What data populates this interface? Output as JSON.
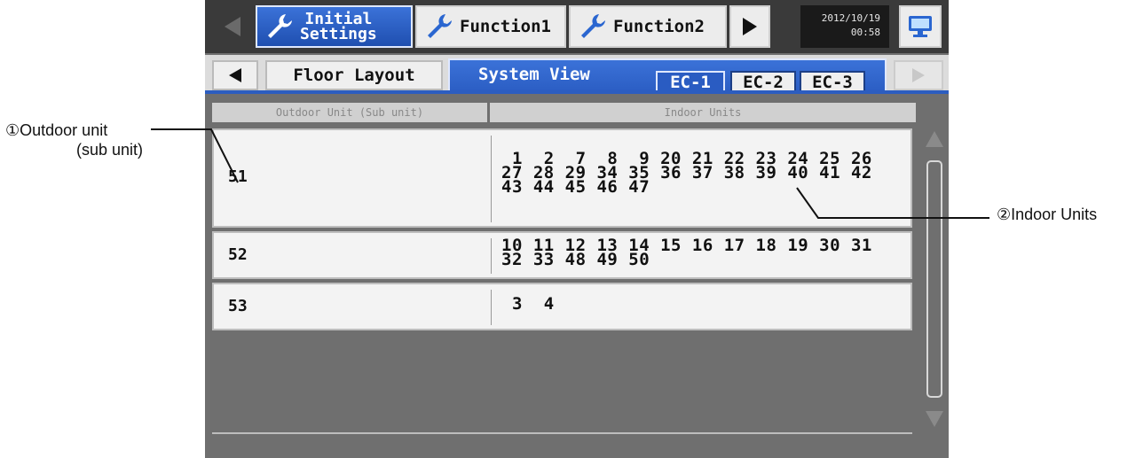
{
  "annotations": {
    "outdoor_line1": "①Outdoor unit",
    "outdoor_line2": "(sub unit)",
    "indoor": "②Indoor Units"
  },
  "header": {
    "tab_initial_line1": "Initial",
    "tab_initial_line2": "Settings",
    "tab_function1": "Function1",
    "tab_function2": "Function2",
    "date": "2012/10/19",
    "time": "00:58"
  },
  "subnav": {
    "floor_layout": "Floor Layout",
    "system_view": "System View",
    "ec_tabs": [
      "EC-1",
      "EC-2",
      "EC-3"
    ],
    "active_ec": "EC-1"
  },
  "table": {
    "col_outdoor": "Outdoor Unit (Sub unit)",
    "col_indoor": "Indoor Units",
    "rows": [
      {
        "id": "51",
        "units": " 1  2  7  8  9 20 21 22 23 24 25 26\n27 28 29 34 35 36 37 38 39 40 41 42\n43 44 45 46 47"
      },
      {
        "id": "52",
        "units": "10 11 12 13 14 15 16 17 18 19 30 31\n32 33 48 49 50"
      },
      {
        "id": "53",
        "units": " 3  4"
      }
    ]
  },
  "colors": {
    "active_tab": "#2a5fc7",
    "screen_bg": "#6f6f6f",
    "topbar": "#3a3a3a"
  }
}
